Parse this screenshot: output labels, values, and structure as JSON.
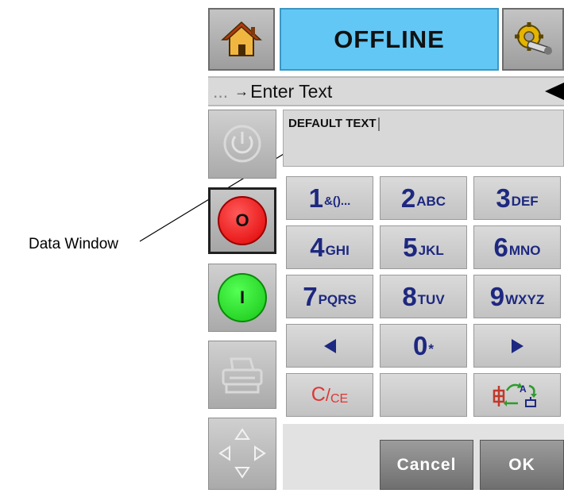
{
  "header": {
    "status": "OFFLINE",
    "home_icon": "home-icon",
    "setup_icon": "setup-gear-icon",
    "status_color": "#62c7f4"
  },
  "breadcrumb": {
    "ellipsis": "...",
    "arrow": "→",
    "label": "Enter Text",
    "back_icon": "back-arrow-icon"
  },
  "side_buttons": {
    "power_icon": "power-icon",
    "stop_label": "O",
    "start_label": "I",
    "print_icon": "printer-icon",
    "navigate_icon": "navigate-arrows-icon",
    "stop_color": "#e00000",
    "start_color": "#16c516"
  },
  "data_window": {
    "text": "DEFAULT TEXT"
  },
  "keypad": {
    "key_1": {
      "digit": "1",
      "letters": "&()..."
    },
    "key_2": {
      "digit": "2",
      "letters": "ABC"
    },
    "key_3": {
      "digit": "3",
      "letters": "DEF"
    },
    "key_4": {
      "digit": "4",
      "letters": "GHI"
    },
    "key_5": {
      "digit": "5",
      "letters": "JKL"
    },
    "key_6": {
      "digit": "6",
      "letters": "MNO"
    },
    "key_7": {
      "digit": "7",
      "letters": "PQRS"
    },
    "key_8": {
      "digit": "8",
      "letters": "TUV"
    },
    "key_9": {
      "digit": "9",
      "letters": "WXYZ"
    },
    "key_0": {
      "digit": "0",
      "letters": "*"
    },
    "clear": {
      "main": "C",
      "sep": "/",
      "sub": "CE"
    },
    "left_icon": "left-arrow-icon",
    "right_icon": "right-arrow-icon",
    "input_method_icon": "input-method-icon"
  },
  "actions": {
    "cancel": "Cancel",
    "ok": "OK"
  },
  "annotation": {
    "label": "Data Window"
  }
}
